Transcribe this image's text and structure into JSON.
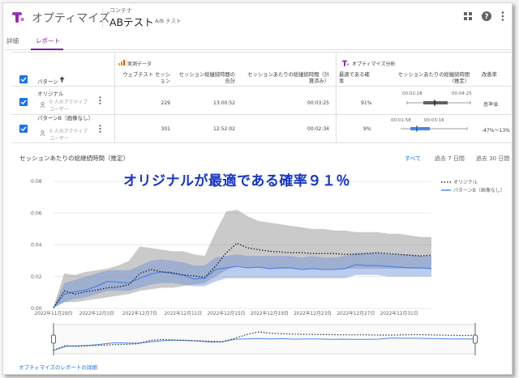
{
  "header": {
    "app_name": "オプティマイズ",
    "container_label": "コンテナ",
    "page_title": "ABテスト",
    "page_type": "A/B テスト"
  },
  "tabs": [
    {
      "label": "詳細",
      "active": false
    },
    {
      "label": "レポート",
      "active": true
    }
  ],
  "table": {
    "variant_header": "パターン",
    "sort_icon": "arrow-up-icon",
    "group_observed": "実測データ",
    "group_optimize": "オプティマイズ分析",
    "columns": [
      "ウェブテスト セッション",
      "セッション総継続時間の合計",
      "セッションあたりの総継続時間（計算済み）",
      "最適である確率",
      "セッションあたりの総継続時間（推定）",
      "改善率"
    ],
    "rows": [
      {
        "name": "オリジナル",
        "users": "0 人のアクティブユーザー",
        "sessions": "229",
        "total_duration": "13:00:52",
        "per_session": "00:03:25",
        "prob_best": "91%",
        "ci_low": "00:02:28",
        "ci_high": "00:04:25",
        "improvement": "基準値"
      },
      {
        "name": "パターンB（画像なし）",
        "users": "0 人のアクティブユーザー",
        "sessions": "301",
        "total_duration": "12:52:02",
        "per_session": "00:02:34",
        "prob_best": "9%",
        "ci_low": "00:01:58",
        "ci_high": "00:03:16",
        "improvement": "-47%～13%"
      }
    ]
  },
  "chart_section": {
    "title": "セッションあたりの総継続時間（推定）",
    "range_options": [
      "すべて",
      "過去 7 日間",
      "過去 30 日間"
    ],
    "selected_range": "すべて",
    "annotation": "オリジナルが最適である確率９１％",
    "footer_link": "オプティマイズのレポートの詳細"
  },
  "colors": {
    "accent": "#1a73e8",
    "tab_active": "#7b1fa2",
    "original": "#333333",
    "variant_b": "#4a86e8",
    "annotation": "#1535c8"
  },
  "chart_data": {
    "type": "line",
    "title": "",
    "xlabel": "",
    "ylabel": "",
    "ylim": [
      0,
      0.08
    ],
    "y_ticks": [
      "0:00",
      "0:02",
      "0:04",
      "0:06",
      "0:08"
    ],
    "x_ticks": [
      "2022年11月29日",
      "2022年12月3日",
      "2022年12月7日",
      "2022年12月11日",
      "2022年12月15日",
      "2022年12月19日",
      "2022年12月23日",
      "2022年12月27日",
      "2022年12月31日"
    ],
    "x": [
      "2022-11-29",
      "2022-11-30",
      "2022-12-01",
      "2022-12-02",
      "2022-12-03",
      "2022-12-04",
      "2022-12-05",
      "2022-12-06",
      "2022-12-07",
      "2022-12-08",
      "2022-12-09",
      "2022-12-10",
      "2022-12-11",
      "2022-12-12",
      "2022-12-13",
      "2022-12-14",
      "2022-12-15",
      "2022-12-16",
      "2022-12-17",
      "2022-12-18",
      "2022-12-19",
      "2022-12-20",
      "2022-12-21",
      "2022-12-22",
      "2022-12-23",
      "2022-12-24",
      "2022-12-25",
      "2022-12-26",
      "2022-12-27",
      "2022-12-28",
      "2022-12-29",
      "2022-12-30",
      "2022-12-31",
      "2023-01-01",
      "2023-01-02",
      "2023-01-03"
    ],
    "legend_position": "top-right",
    "series": [
      {
        "name": "オリジナル",
        "style": "dotted",
        "values": [
          0.0004,
          0.011,
          0.009,
          0.0105,
          0.0115,
          0.013,
          0.0135,
          0.015,
          0.022,
          0.0245,
          0.023,
          0.0225,
          0.021,
          0.0205,
          0.0195,
          0.0265,
          0.035,
          0.041,
          0.038,
          0.037,
          0.036,
          0.0355,
          0.035,
          0.035,
          0.0345,
          0.0345,
          0.0345,
          0.034,
          0.034,
          0.0345,
          0.035,
          0.0345,
          0.034,
          0.0335,
          0.033,
          0.0335
        ],
        "lower": [
          0.0003,
          0.004,
          0.004,
          0.005,
          0.006,
          0.007,
          0.008,
          0.009,
          0.011,
          0.012,
          0.013,
          0.013,
          0.014,
          0.015,
          0.016,
          0.02,
          0.024,
          0.027,
          0.026,
          0.026,
          0.025,
          0.025,
          0.025,
          0.025,
          0.025,
          0.025,
          0.025,
          0.025,
          0.025,
          0.025,
          0.025,
          0.025,
          0.025,
          0.025,
          0.025,
          0.025
        ],
        "upper": [
          0.0008,
          0.022,
          0.021,
          0.023,
          0.024,
          0.025,
          0.027,
          0.03,
          0.039,
          0.038,
          0.037,
          0.036,
          0.036,
          0.034,
          0.033,
          0.048,
          0.061,
          0.062,
          0.058,
          0.055,
          0.054,
          0.053,
          0.052,
          0.051,
          0.05,
          0.05,
          0.049,
          0.049,
          0.048,
          0.048,
          0.048,
          0.047,
          0.047,
          0.046,
          0.045,
          0.045
        ]
      },
      {
        "name": "パターンB（画像なし）",
        "style": "solid",
        "values": [
          0.0004,
          0.009,
          0.0105,
          0.0115,
          0.014,
          0.017,
          0.0165,
          0.016,
          0.019,
          0.0215,
          0.023,
          0.022,
          0.021,
          0.0185,
          0.019,
          0.0245,
          0.0255,
          0.0265,
          0.0255,
          0.026,
          0.025,
          0.0255,
          0.0255,
          0.0245,
          0.025,
          0.0245,
          0.0245,
          0.025,
          0.0275,
          0.027,
          0.027,
          0.0265,
          0.026,
          0.0255,
          0.0255,
          0.025
        ],
        "lower": [
          0.0003,
          0.004,
          0.006,
          0.007,
          0.009,
          0.011,
          0.011,
          0.011,
          0.013,
          0.015,
          0.016,
          0.016,
          0.015,
          0.014,
          0.014,
          0.017,
          0.019,
          0.019,
          0.019,
          0.019,
          0.019,
          0.019,
          0.019,
          0.019,
          0.019,
          0.019,
          0.019,
          0.019,
          0.021,
          0.021,
          0.021,
          0.02,
          0.02,
          0.02,
          0.02,
          0.02
        ],
        "upper": [
          0.0008,
          0.016,
          0.018,
          0.02,
          0.022,
          0.024,
          0.024,
          0.024,
          0.027,
          0.03,
          0.031,
          0.03,
          0.029,
          0.027,
          0.027,
          0.032,
          0.033,
          0.034,
          0.033,
          0.033,
          0.033,
          0.033,
          0.033,
          0.032,
          0.033,
          0.032,
          0.032,
          0.033,
          0.035,
          0.035,
          0.035,
          0.034,
          0.034,
          0.034,
          0.033,
          0.033
        ]
      }
    ]
  }
}
